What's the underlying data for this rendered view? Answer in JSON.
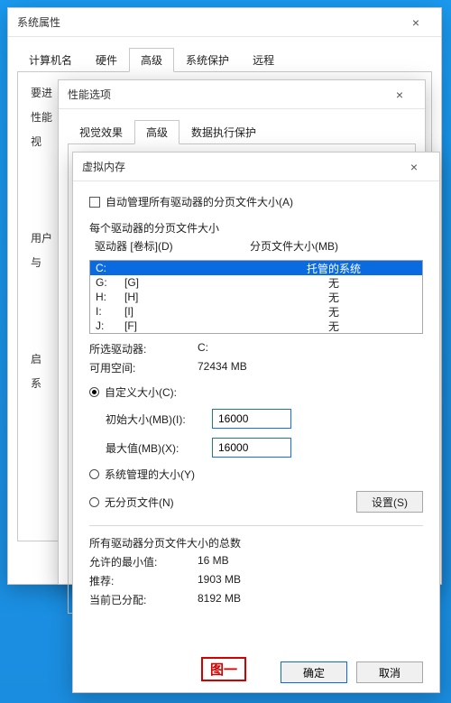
{
  "sysprop": {
    "title": "系统属性",
    "tabs": [
      "计算机名",
      "硬件",
      "高级",
      "系统保护",
      "远程"
    ],
    "activeTabIndex": 2,
    "panel": {
      "line1": "要进",
      "line2": "性能",
      "line3": "视",
      "line4": "用户",
      "line5": "与",
      "line6": "启",
      "line7": "系"
    }
  },
  "perfopt": {
    "title": "性能选项",
    "tabs": [
      "视觉效果",
      "高级",
      "数据执行保护"
    ],
    "activeTabIndex": 1
  },
  "virtmem": {
    "title": "虚拟内存",
    "autoManageLabel": "自动管理所有驱动器的分页文件大小(A)",
    "autoManageChecked": false,
    "perDriveTitle": "每个驱动器的分页文件大小",
    "headerDrive": "驱动器 [卷标](D)",
    "headerPage": "分页文件大小(MB)",
    "drives": [
      {
        "letter": "C:",
        "label": "",
        "page": "托管的系统",
        "selected": true
      },
      {
        "letter": "G:",
        "label": "[G]",
        "page": "无",
        "selected": false
      },
      {
        "letter": "H:",
        "label": "[H]",
        "page": "无",
        "selected": false
      },
      {
        "letter": "I:",
        "label": "[I]",
        "page": "无",
        "selected": false
      },
      {
        "letter": "J:",
        "label": "[F]",
        "page": "无",
        "selected": false
      }
    ],
    "selectedDriveLabel": "所选驱动器:",
    "selectedDriveValue": "C:",
    "freeSpaceLabel": "可用空间:",
    "freeSpaceValue": "72434 MB",
    "customSizeLabel": "自定义大小(C):",
    "initialSizeLabel": "初始大小(MB)(I):",
    "initialSizeValue": "16000",
    "maxSizeLabel": "最大值(MB)(X):",
    "maxSizeValue": "16000",
    "sysManagedLabel": "系统管理的大小(Y)",
    "noPageLabel": "无分页文件(N)",
    "setBtn": "设置(S)",
    "totalsTitle": "所有驱动器分页文件大小的总数",
    "minLabel": "允许的最小值:",
    "minValue": "16 MB",
    "recLabel": "推荐:",
    "recValue": "1903 MB",
    "curLabel": "当前已分配:",
    "curValue": "8192 MB",
    "okBtn": "确定",
    "cancelBtn": "取消",
    "annotation": "图一"
  }
}
